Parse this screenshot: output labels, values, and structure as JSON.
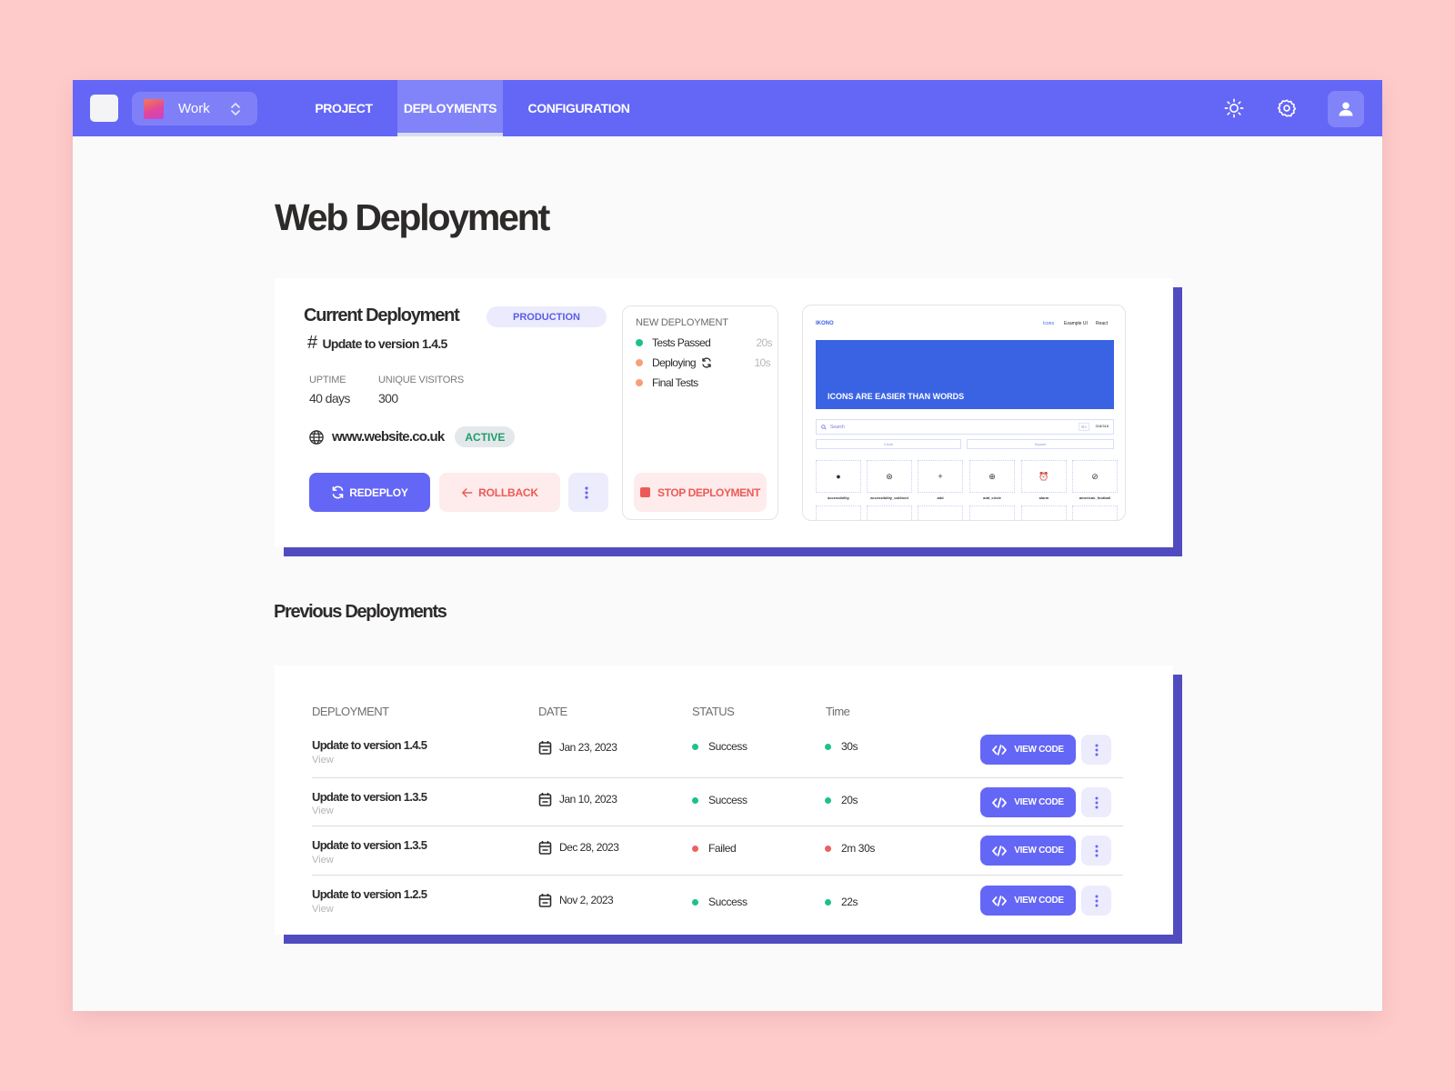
{
  "topbar": {
    "workspace": {
      "label": "Work"
    },
    "tabs": [
      {
        "label": "PROJECT",
        "active": false
      },
      {
        "label": "DEPLOYMENTS",
        "active": true
      },
      {
        "label": "CONFIGURATION",
        "active": false
      }
    ],
    "icons": [
      "sun-icon",
      "gear-icon",
      "user-icon"
    ]
  },
  "page": {
    "title": "Web Deployment"
  },
  "current": {
    "title": "Current Deployment",
    "environment_badge": "PRODUCTION",
    "version_hash": "#",
    "version": "Update to version 1.4.5",
    "uptime_label": "UPTIME",
    "uptime_value": "40 days",
    "visitors_label": "UNIQUE VISITORS",
    "visitors_value": "300",
    "url": "www.website.co.uk",
    "status_badge": "ACTIVE",
    "buttons": {
      "redeploy": "REDEPLOY",
      "rollback": "ROLLBACK"
    }
  },
  "new_deployment": {
    "title": "NEW DEPLOYMENT",
    "steps": [
      {
        "label": "Tests Passed",
        "time": "20s",
        "color": "#1fbf8f"
      },
      {
        "label": "Deploying",
        "time": "10s",
        "color": "#f6a07a"
      },
      {
        "label": "Final Tests",
        "time": "",
        "color": "#f6a07a"
      }
    ],
    "stop_label": "STOP DEPLOYMENT"
  },
  "preview": {
    "logo": "IKONO",
    "nav": [
      "Icons",
      "Example UI",
      "React"
    ],
    "hero": "ICONS ARE EASIER THAN WORDS",
    "search_placeholder": "Search",
    "kbd": "⌘K",
    "count": "318/318",
    "toggles": [
      "Circle",
      "Square"
    ],
    "tiles": [
      {
        "glyph": "●",
        "label": "accessibility"
      },
      {
        "glyph": "⊛",
        "label": "accessibility_outlined"
      },
      {
        "glyph": "+",
        "label": "add"
      },
      {
        "glyph": "⊕",
        "label": "add_circle"
      },
      {
        "glyph": "⏰",
        "label": "alarm"
      },
      {
        "glyph": "⊘",
        "label": "american_football"
      }
    ]
  },
  "previous": {
    "title": "Previous Deployments",
    "columns": [
      "DEPLOYMENT",
      "DATE",
      "STATUS",
      "Time"
    ],
    "rows": [
      {
        "name": "Update to version 1.4.5",
        "link": "View",
        "date": "Jan 23, 2023",
        "status": "Success",
        "time": "30s",
        "color": "#1fbf8f"
      },
      {
        "name": "Update to version 1.3.5",
        "link": "View",
        "date": "Jan 10, 2023",
        "status": "Success",
        "time": "20s",
        "color": "#1fbf8f"
      },
      {
        "name": "Update to version 1.3.5",
        "link": "View",
        "date": "Dec 28, 2023",
        "status": "Failed",
        "time": "2m 30s",
        "color": "#ef5f5f"
      },
      {
        "name": "Update to version 1.2.5",
        "link": "View",
        "date": "Nov 2, 2023",
        "status": "Success",
        "time": "22s",
        "color": "#1fbf8f"
      }
    ],
    "view_code_label": "VIEW CODE"
  },
  "colors": {
    "accent": "#6466f6",
    "accent_dark": "#504cc0",
    "success": "#1fbf8f",
    "danger": "#ec5a58",
    "background": "#ffcaca"
  }
}
